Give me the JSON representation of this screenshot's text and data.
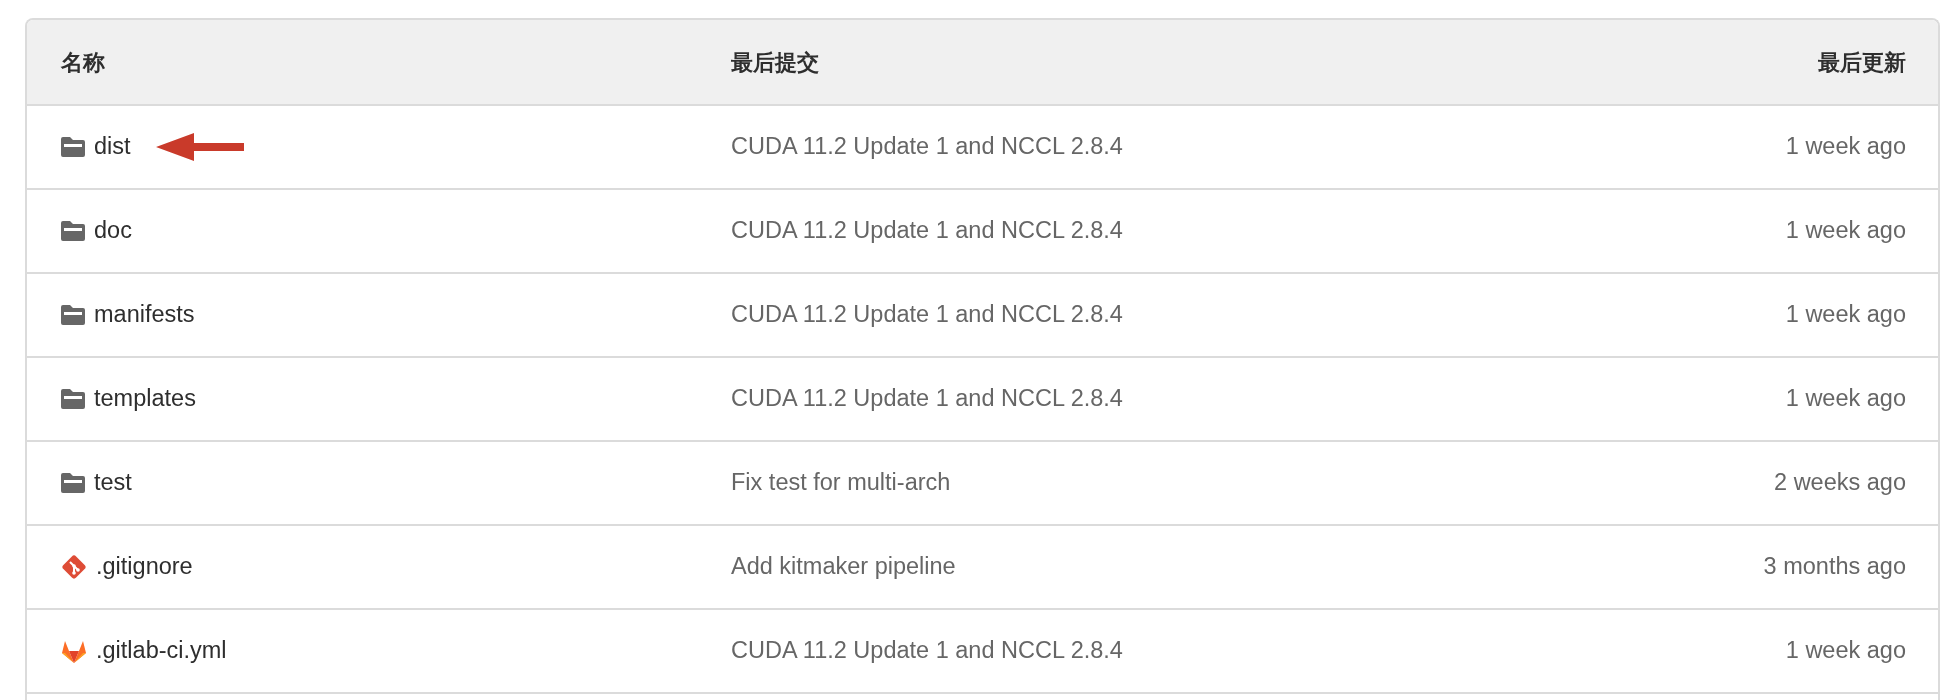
{
  "table": {
    "columns": [
      "名称",
      "最后提交",
      "最后更新"
    ],
    "rows": [
      {
        "name": "dist",
        "kind": "folder",
        "commit": "CUDA 11.2 Update 1 and NCCL 2.8.4",
        "updated": "1 week ago",
        "pointed": true
      },
      {
        "name": "doc",
        "kind": "folder",
        "commit": "CUDA 11.2 Update 1 and NCCL 2.8.4",
        "updated": "1 week ago",
        "pointed": false
      },
      {
        "name": "manifests",
        "kind": "folder",
        "commit": "CUDA 11.2 Update 1 and NCCL 2.8.4",
        "updated": "1 week ago",
        "pointed": false
      },
      {
        "name": "templates",
        "kind": "folder",
        "commit": "CUDA 11.2 Update 1 and NCCL 2.8.4",
        "updated": "1 week ago",
        "pointed": false
      },
      {
        "name": "test",
        "kind": "folder",
        "commit": "Fix test for multi-arch",
        "updated": "2 weeks ago",
        "pointed": false
      },
      {
        "name": ".gitignore",
        "kind": "git",
        "commit": "Add kitmaker pipeline",
        "updated": "3 months ago",
        "pointed": false
      },
      {
        "name": ".gitlab-ci.yml",
        "kind": "gitlab",
        "commit": "CUDA 11.2 Update 1 and NCCL 2.8.4",
        "updated": "1 week ago",
        "pointed": false
      }
    ]
  }
}
